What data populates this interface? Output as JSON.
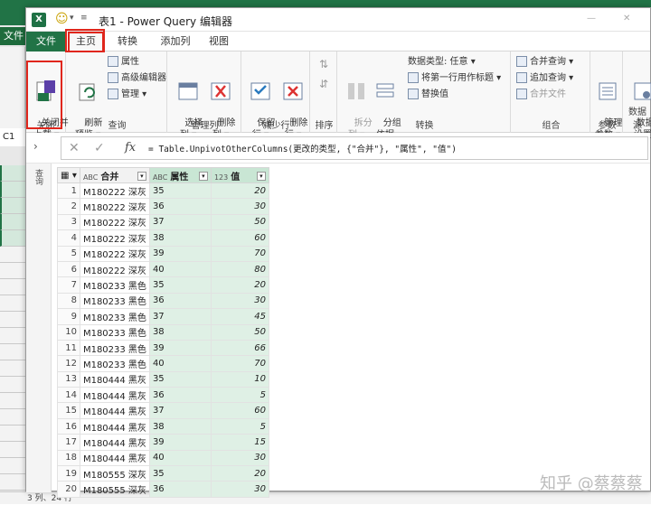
{
  "excel": {
    "file_tab": "文件",
    "cell_ref": "C1",
    "status": "3 列、24 行"
  },
  "title": {
    "xl": "X",
    "text": "表1 - Power Query 编辑器",
    "minimize": "—",
    "close": "✕"
  },
  "tabs": [
    "文件",
    "主页",
    "转换",
    "添加列",
    "视图"
  ],
  "ribbon": {
    "close_load": "关闭并\n上载 ▾",
    "group_close": "关闭",
    "refresh": "刷新\n预览 ▾",
    "props": "属性",
    "advanced": "高级编辑器",
    "manage": "管理 ▾",
    "group_query": "查询",
    "choose_cols": "选择\n列 ▾",
    "remove_cols": "删除\n列 ▾",
    "group_manage_cols": "管理列",
    "keep_rows": "保留\n行 ▾",
    "remove_rows": "删除\n行 ▾",
    "group_reduce_rows": "减少行",
    "group_sort": "排序",
    "split": "拆分\n列 ▾",
    "groupby": "分组\n依据",
    "datatype": "数据类型: 任意 ▾",
    "first_row": "将第一行用作标题 ▾",
    "replace": "替换值",
    "group_transform": "转换",
    "merge_q": "合并查询 ▾",
    "append_q": "追加查询 ▾",
    "merge_f": "合并文件",
    "group_combine": "组合",
    "manage_params": "管理\n参数 ▾",
    "group_params": "参数",
    "ds_settings": "数据源\n设置",
    "group_ds": "数据源"
  },
  "formula": {
    "check": "✓",
    "cancel": "✕",
    "fx": "fx",
    "text": "= Table.UnpivotOtherColumns(更改的类型, {\"合并\"}, \"属性\", \"值\")"
  },
  "query_panel": "查询",
  "table": {
    "headers": [
      "合并",
      "属性",
      "值"
    ],
    "type_icons": [
      "ABC",
      "ABC",
      "123"
    ],
    "rows": [
      [
        "1",
        "M180222 深灰",
        "35",
        "20"
      ],
      [
        "2",
        "M180222 深灰",
        "36",
        "30"
      ],
      [
        "3",
        "M180222 深灰",
        "37",
        "50"
      ],
      [
        "4",
        "M180222 深灰",
        "38",
        "60"
      ],
      [
        "5",
        "M180222 深灰",
        "39",
        "70"
      ],
      [
        "6",
        "M180222 深灰",
        "40",
        "80"
      ],
      [
        "7",
        "M180233 黑色",
        "35",
        "20"
      ],
      [
        "8",
        "M180233 黑色",
        "36",
        "30"
      ],
      [
        "9",
        "M180233 黑色",
        "37",
        "45"
      ],
      [
        "10",
        "M180233 黑色",
        "38",
        "50"
      ],
      [
        "11",
        "M180233 黑色",
        "39",
        "66"
      ],
      [
        "12",
        "M180233 黑色",
        "40",
        "70"
      ],
      [
        "13",
        "M180444 黑灰",
        "35",
        "10"
      ],
      [
        "14",
        "M180444 黑灰",
        "36",
        "5"
      ],
      [
        "15",
        "M180444 黑灰",
        "37",
        "60"
      ],
      [
        "16",
        "M180444 黑灰",
        "38",
        "5"
      ],
      [
        "17",
        "M180444 黑灰",
        "39",
        "15"
      ],
      [
        "18",
        "M180444 黑灰",
        "40",
        "30"
      ],
      [
        "19",
        "M180555 深灰",
        "35",
        "20"
      ],
      [
        "20",
        "M180555 深灰",
        "36",
        "30"
      ]
    ]
  },
  "watermark": "知乎 @蔡蔡蔡"
}
